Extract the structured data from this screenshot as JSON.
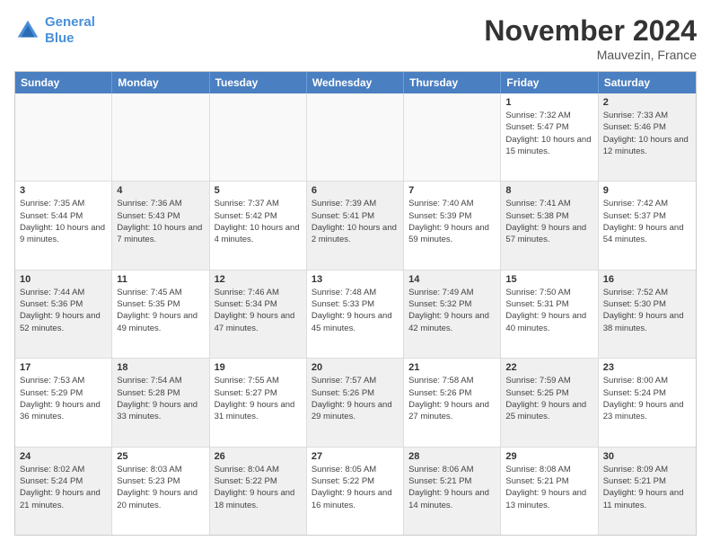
{
  "logo": {
    "line1": "General",
    "line2": "Blue"
  },
  "title": "November 2024",
  "location": "Mauvezin, France",
  "headers": [
    "Sunday",
    "Monday",
    "Tuesday",
    "Wednesday",
    "Thursday",
    "Friday",
    "Saturday"
  ],
  "rows": [
    [
      {
        "day": "",
        "info": "",
        "empty": true
      },
      {
        "day": "",
        "info": "",
        "empty": true
      },
      {
        "day": "",
        "info": "",
        "empty": true
      },
      {
        "day": "",
        "info": "",
        "empty": true
      },
      {
        "day": "",
        "info": "",
        "empty": true
      },
      {
        "day": "1",
        "info": "Sunrise: 7:32 AM\nSunset: 5:47 PM\nDaylight: 10 hours and 15 minutes.",
        "empty": false
      },
      {
        "day": "2",
        "info": "Sunrise: 7:33 AM\nSunset: 5:46 PM\nDaylight: 10 hours and 12 minutes.",
        "empty": false,
        "shaded": true
      }
    ],
    [
      {
        "day": "3",
        "info": "Sunrise: 7:35 AM\nSunset: 5:44 PM\nDaylight: 10 hours and 9 minutes.",
        "empty": false
      },
      {
        "day": "4",
        "info": "Sunrise: 7:36 AM\nSunset: 5:43 PM\nDaylight: 10 hours and 7 minutes.",
        "empty": false,
        "shaded": true
      },
      {
        "day": "5",
        "info": "Sunrise: 7:37 AM\nSunset: 5:42 PM\nDaylight: 10 hours and 4 minutes.",
        "empty": false
      },
      {
        "day": "6",
        "info": "Sunrise: 7:39 AM\nSunset: 5:41 PM\nDaylight: 10 hours and 2 minutes.",
        "empty": false,
        "shaded": true
      },
      {
        "day": "7",
        "info": "Sunrise: 7:40 AM\nSunset: 5:39 PM\nDaylight: 9 hours and 59 minutes.",
        "empty": false
      },
      {
        "day": "8",
        "info": "Sunrise: 7:41 AM\nSunset: 5:38 PM\nDaylight: 9 hours and 57 minutes.",
        "empty": false,
        "shaded": true
      },
      {
        "day": "9",
        "info": "Sunrise: 7:42 AM\nSunset: 5:37 PM\nDaylight: 9 hours and 54 minutes.",
        "empty": false
      }
    ],
    [
      {
        "day": "10",
        "info": "Sunrise: 7:44 AM\nSunset: 5:36 PM\nDaylight: 9 hours and 52 minutes.",
        "empty": false,
        "shaded": true
      },
      {
        "day": "11",
        "info": "Sunrise: 7:45 AM\nSunset: 5:35 PM\nDaylight: 9 hours and 49 minutes.",
        "empty": false
      },
      {
        "day": "12",
        "info": "Sunrise: 7:46 AM\nSunset: 5:34 PM\nDaylight: 9 hours and 47 minutes.",
        "empty": false,
        "shaded": true
      },
      {
        "day": "13",
        "info": "Sunrise: 7:48 AM\nSunset: 5:33 PM\nDaylight: 9 hours and 45 minutes.",
        "empty": false
      },
      {
        "day": "14",
        "info": "Sunrise: 7:49 AM\nSunset: 5:32 PM\nDaylight: 9 hours and 42 minutes.",
        "empty": false,
        "shaded": true
      },
      {
        "day": "15",
        "info": "Sunrise: 7:50 AM\nSunset: 5:31 PM\nDaylight: 9 hours and 40 minutes.",
        "empty": false
      },
      {
        "day": "16",
        "info": "Sunrise: 7:52 AM\nSunset: 5:30 PM\nDaylight: 9 hours and 38 minutes.",
        "empty": false,
        "shaded": true
      }
    ],
    [
      {
        "day": "17",
        "info": "Sunrise: 7:53 AM\nSunset: 5:29 PM\nDaylight: 9 hours and 36 minutes.",
        "empty": false
      },
      {
        "day": "18",
        "info": "Sunrise: 7:54 AM\nSunset: 5:28 PM\nDaylight: 9 hours and 33 minutes.",
        "empty": false,
        "shaded": true
      },
      {
        "day": "19",
        "info": "Sunrise: 7:55 AM\nSunset: 5:27 PM\nDaylight: 9 hours and 31 minutes.",
        "empty": false
      },
      {
        "day": "20",
        "info": "Sunrise: 7:57 AM\nSunset: 5:26 PM\nDaylight: 9 hours and 29 minutes.",
        "empty": false,
        "shaded": true
      },
      {
        "day": "21",
        "info": "Sunrise: 7:58 AM\nSunset: 5:26 PM\nDaylight: 9 hours and 27 minutes.",
        "empty": false
      },
      {
        "day": "22",
        "info": "Sunrise: 7:59 AM\nSunset: 5:25 PM\nDaylight: 9 hours and 25 minutes.",
        "empty": false,
        "shaded": true
      },
      {
        "day": "23",
        "info": "Sunrise: 8:00 AM\nSunset: 5:24 PM\nDaylight: 9 hours and 23 minutes.",
        "empty": false
      }
    ],
    [
      {
        "day": "24",
        "info": "Sunrise: 8:02 AM\nSunset: 5:24 PM\nDaylight: 9 hours and 21 minutes.",
        "empty": false,
        "shaded": true
      },
      {
        "day": "25",
        "info": "Sunrise: 8:03 AM\nSunset: 5:23 PM\nDaylight: 9 hours and 20 minutes.",
        "empty": false
      },
      {
        "day": "26",
        "info": "Sunrise: 8:04 AM\nSunset: 5:22 PM\nDaylight: 9 hours and 18 minutes.",
        "empty": false,
        "shaded": true
      },
      {
        "day": "27",
        "info": "Sunrise: 8:05 AM\nSunset: 5:22 PM\nDaylight: 9 hours and 16 minutes.",
        "empty": false
      },
      {
        "day": "28",
        "info": "Sunrise: 8:06 AM\nSunset: 5:21 PM\nDaylight: 9 hours and 14 minutes.",
        "empty": false,
        "shaded": true
      },
      {
        "day": "29",
        "info": "Sunrise: 8:08 AM\nSunset: 5:21 PM\nDaylight: 9 hours and 13 minutes.",
        "empty": false
      },
      {
        "day": "30",
        "info": "Sunrise: 8:09 AM\nSunset: 5:21 PM\nDaylight: 9 hours and 11 minutes.",
        "empty": false,
        "shaded": true
      }
    ]
  ]
}
